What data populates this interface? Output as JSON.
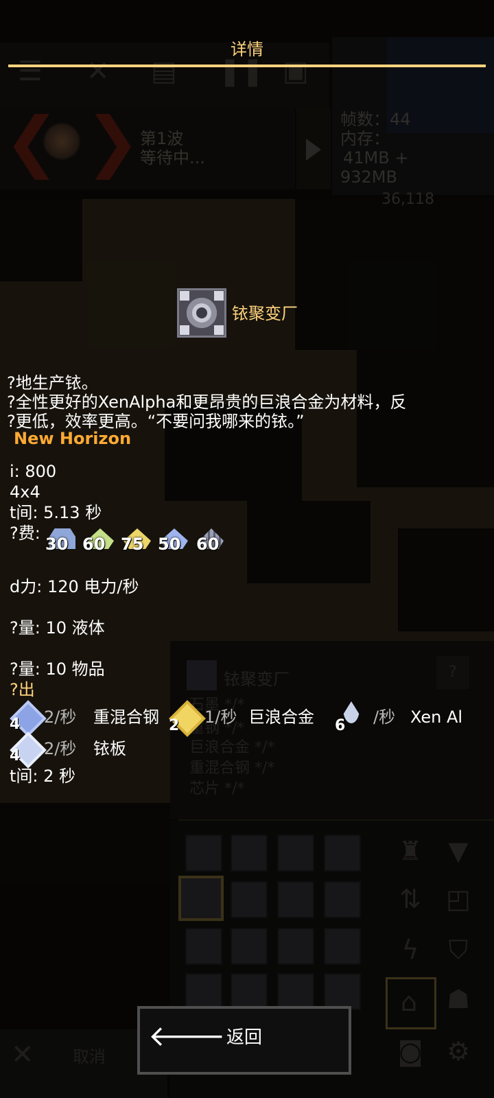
{
  "dialog": {
    "title": "详情",
    "block_name": "铱聚变厂",
    "description_lines": [
      "?地生产铱。",
      "?全性更好的XenAlpha和更昂贵的巨浪合金为材料，反",
      "?更低，效率更高。“不要问我哪来的铱。”"
    ],
    "mod_name": "New Horizon",
    "stats": {
      "health": "i: 800",
      "size": "4x4",
      "build_time": "t间: 5.13 秒",
      "build_cost_label": "?费:",
      "power": "d力: 120 电力/秒",
      "liquid_capacity": "?量: 10 液体",
      "item_capacity": "?量: 10 物品",
      "output_label": "?出",
      "craft_time": "t间: 2 秒"
    },
    "requirements": [
      {
        "count": "30",
        "icon": "titanium-plate-icon",
        "color": "#8fa6d8"
      },
      {
        "count": "60",
        "icon": "zeta-alloy-icon",
        "color": "#c6e08a"
      },
      {
        "count": "75",
        "icon": "surge-alloy-icon",
        "color": "#ecd66a"
      },
      {
        "count": "50",
        "icon": "metaglass-icon",
        "color": "#9fb4ee"
      },
      {
        "count": "60",
        "icon": "multi-steel-icon",
        "color": "#9aa0b6"
      }
    ],
    "inputs": [
      {
        "badge": "4",
        "rate": "2/秒",
        "name": "重混合钢",
        "icon": "multi-steel-icon",
        "color": "#8ca3e6"
      },
      {
        "badge": "2",
        "rate": "1/秒",
        "name": "巨浪合金",
        "icon": "surge-alloy-icon",
        "color": "#f1d562"
      },
      {
        "badge": "6",
        "rate": "/秒",
        "name": "Xen Al",
        "icon": "xen-alpha-droplet-icon",
        "color": "#c9d3e8"
      }
    ],
    "output": {
      "badge": "4",
      "rate": "2/秒",
      "name": "铱板",
      "icon": "irayrondium-icon",
      "color": "#c7d3f0"
    },
    "back_label": "返回"
  },
  "hud": {
    "wave": "第1波",
    "wave_status": "等待中...",
    "fps": "帧数：44",
    "memory_label": "内存：",
    "memory_value": "41MB +",
    "memory_value2": "932MB",
    "coords": "36,118",
    "cancel_label": "取消"
  },
  "info_panel": {
    "name": "铱聚变厂",
    "help": "?",
    "lines": [
      "石墨 */*",
      "重钢 */*",
      "巨浪合金 */*",
      "重混合钢 */*",
      "芯片 */*"
    ]
  }
}
